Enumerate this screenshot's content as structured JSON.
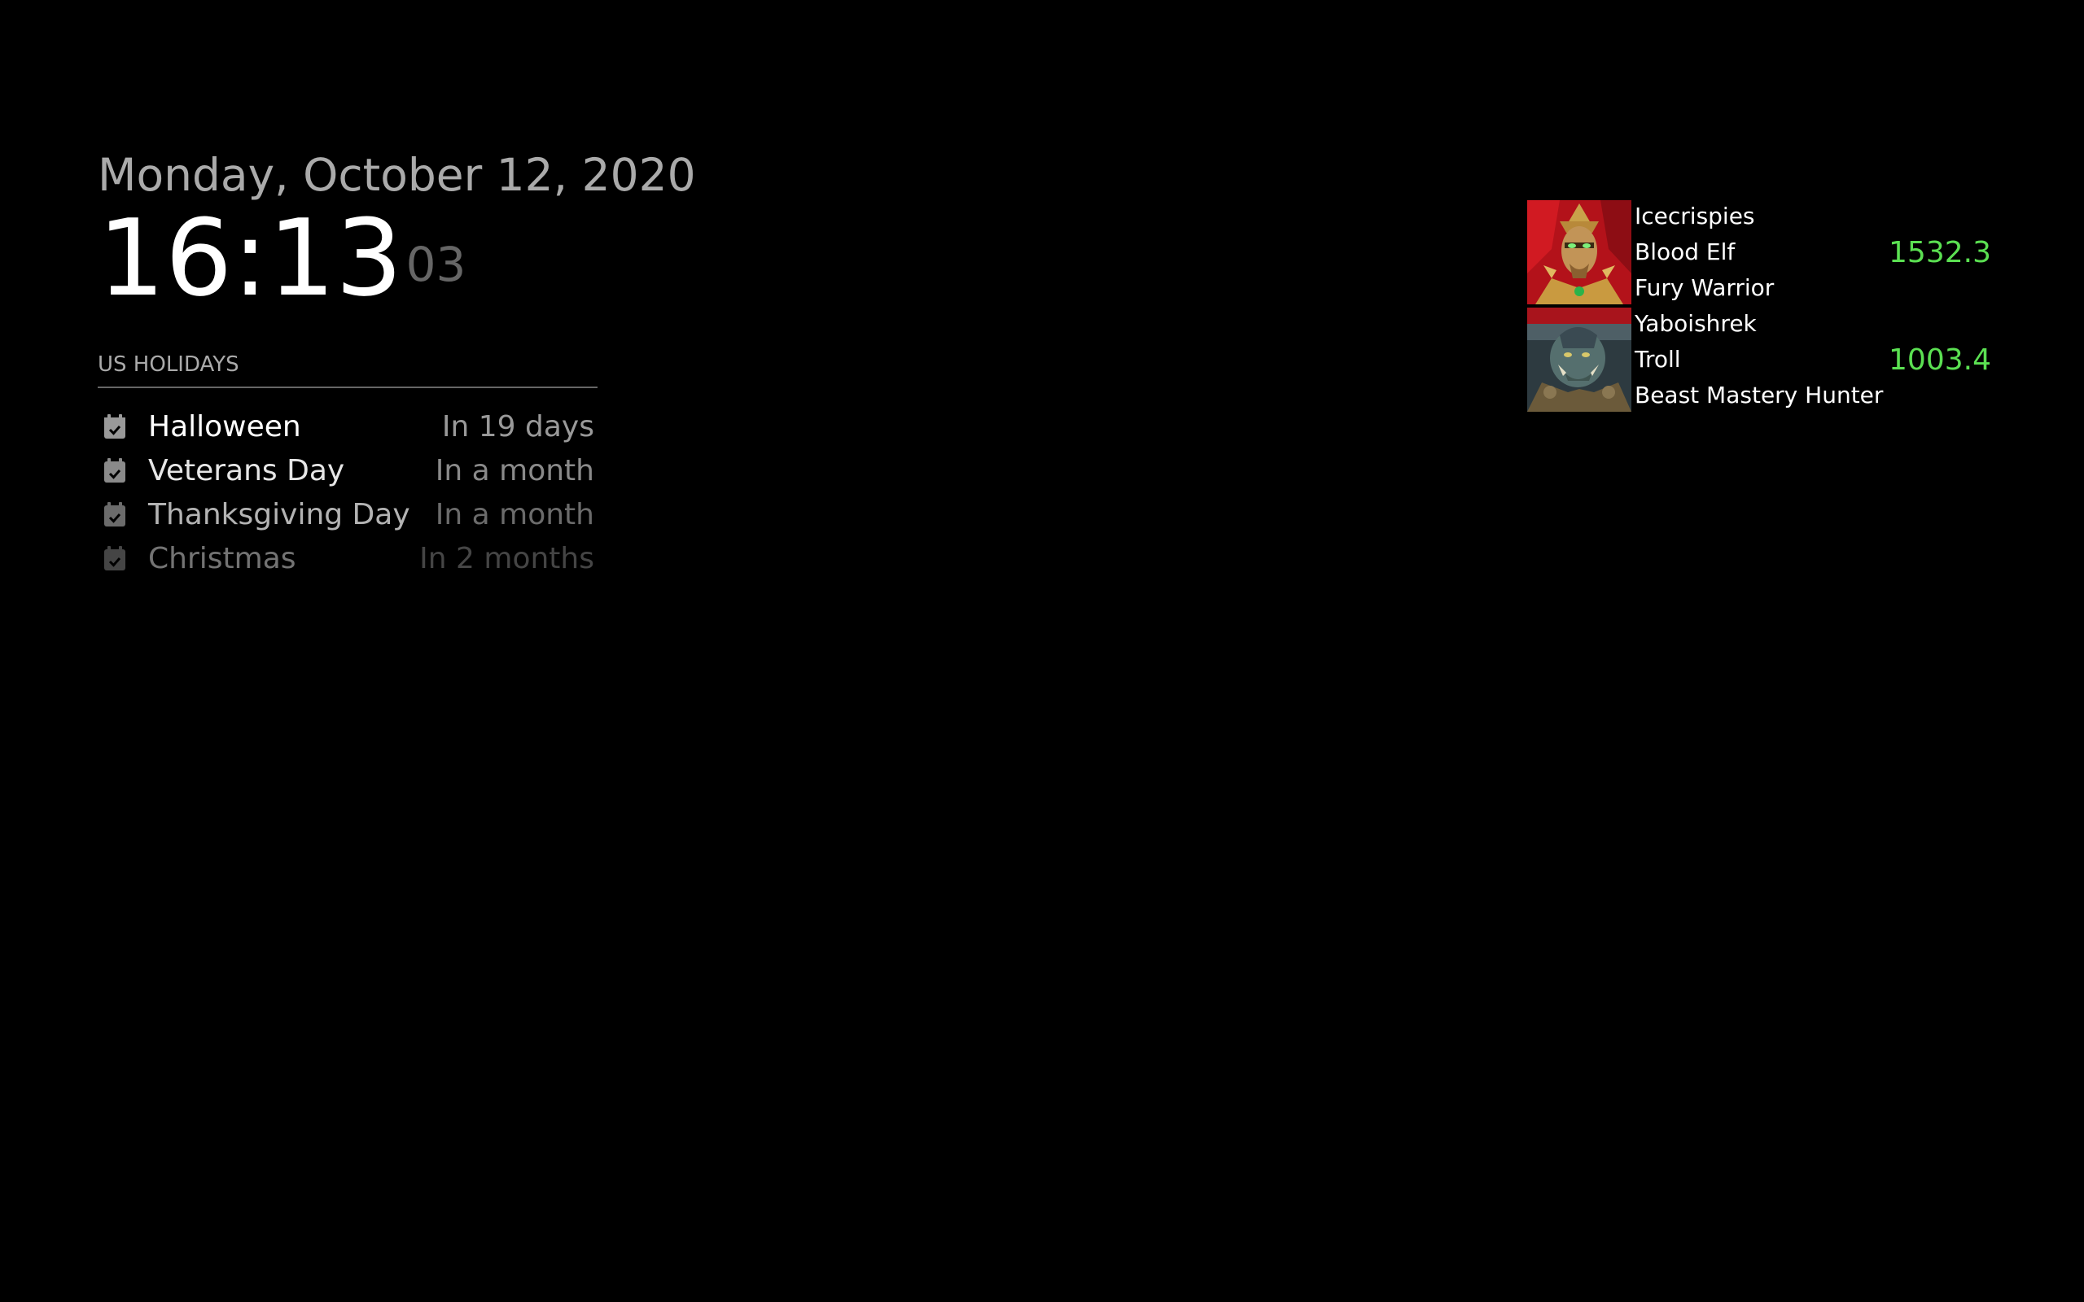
{
  "clock": {
    "date": "Monday, October 12, 2020",
    "hours_minutes": "16:13",
    "seconds": "03"
  },
  "calendar": {
    "header": "US Holidays",
    "icon": "calendar-check-icon",
    "events": [
      {
        "title": "Halloween",
        "when": "In 19 days",
        "opacity": 1.0
      },
      {
        "title": "Veterans Day",
        "when": "In a month",
        "opacity": 0.9
      },
      {
        "title": "Thanksgiving Day",
        "when": "In a month",
        "opacity": 0.7
      },
      {
        "title": "Christmas",
        "when": "In 2 months",
        "opacity": 0.45
      }
    ]
  },
  "characters": [
    {
      "name": "Icecrispies",
      "race": "Blood Elf",
      "spec": "Fury Warrior",
      "score": "1532.3",
      "portrait": "blood-elf-portrait"
    },
    {
      "name": "Yaboishrek",
      "race": "Troll",
      "spec": "Beast Mastery Hunter",
      "score": "1003.4",
      "portrait": "troll-portrait"
    }
  ],
  "colors": {
    "background": "#000000",
    "score": "#5be052",
    "muted": "#aaaaaa"
  }
}
